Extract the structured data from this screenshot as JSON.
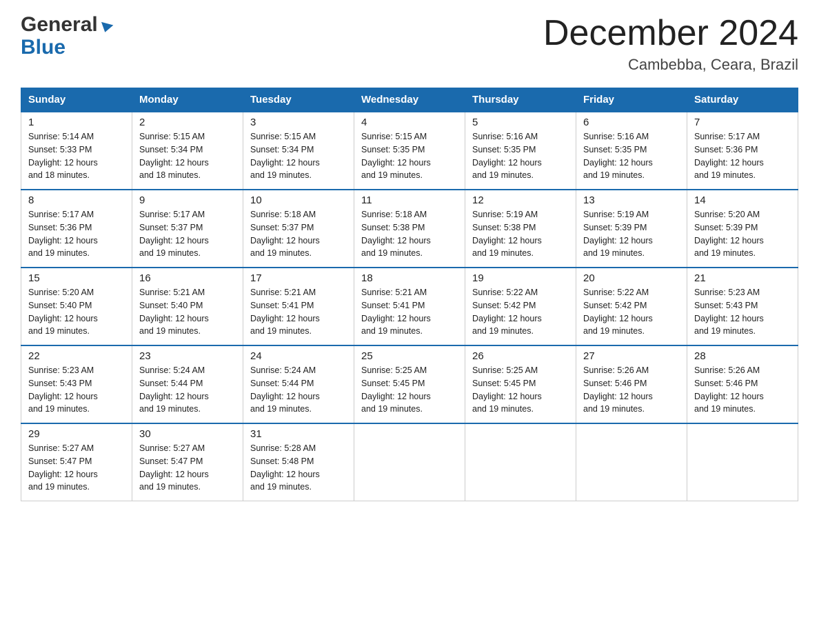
{
  "logo": {
    "line1": "General",
    "line2": "Blue"
  },
  "title": "December 2024",
  "subtitle": "Cambebba, Ceara, Brazil",
  "days_of_week": [
    "Sunday",
    "Monday",
    "Tuesday",
    "Wednesday",
    "Thursday",
    "Friday",
    "Saturday"
  ],
  "weeks": [
    [
      {
        "day": 1,
        "sunrise": "5:14 AM",
        "sunset": "5:33 PM",
        "daylight": "12 hours and 18 minutes."
      },
      {
        "day": 2,
        "sunrise": "5:15 AM",
        "sunset": "5:34 PM",
        "daylight": "12 hours and 18 minutes."
      },
      {
        "day": 3,
        "sunrise": "5:15 AM",
        "sunset": "5:34 PM",
        "daylight": "12 hours and 19 minutes."
      },
      {
        "day": 4,
        "sunrise": "5:15 AM",
        "sunset": "5:35 PM",
        "daylight": "12 hours and 19 minutes."
      },
      {
        "day": 5,
        "sunrise": "5:16 AM",
        "sunset": "5:35 PM",
        "daylight": "12 hours and 19 minutes."
      },
      {
        "day": 6,
        "sunrise": "5:16 AM",
        "sunset": "5:35 PM",
        "daylight": "12 hours and 19 minutes."
      },
      {
        "day": 7,
        "sunrise": "5:17 AM",
        "sunset": "5:36 PM",
        "daylight": "12 hours and 19 minutes."
      }
    ],
    [
      {
        "day": 8,
        "sunrise": "5:17 AM",
        "sunset": "5:36 PM",
        "daylight": "12 hours and 19 minutes."
      },
      {
        "day": 9,
        "sunrise": "5:17 AM",
        "sunset": "5:37 PM",
        "daylight": "12 hours and 19 minutes."
      },
      {
        "day": 10,
        "sunrise": "5:18 AM",
        "sunset": "5:37 PM",
        "daylight": "12 hours and 19 minutes."
      },
      {
        "day": 11,
        "sunrise": "5:18 AM",
        "sunset": "5:38 PM",
        "daylight": "12 hours and 19 minutes."
      },
      {
        "day": 12,
        "sunrise": "5:19 AM",
        "sunset": "5:38 PM",
        "daylight": "12 hours and 19 minutes."
      },
      {
        "day": 13,
        "sunrise": "5:19 AM",
        "sunset": "5:39 PM",
        "daylight": "12 hours and 19 minutes."
      },
      {
        "day": 14,
        "sunrise": "5:20 AM",
        "sunset": "5:39 PM",
        "daylight": "12 hours and 19 minutes."
      }
    ],
    [
      {
        "day": 15,
        "sunrise": "5:20 AM",
        "sunset": "5:40 PM",
        "daylight": "12 hours and 19 minutes."
      },
      {
        "day": 16,
        "sunrise": "5:21 AM",
        "sunset": "5:40 PM",
        "daylight": "12 hours and 19 minutes."
      },
      {
        "day": 17,
        "sunrise": "5:21 AM",
        "sunset": "5:41 PM",
        "daylight": "12 hours and 19 minutes."
      },
      {
        "day": 18,
        "sunrise": "5:21 AM",
        "sunset": "5:41 PM",
        "daylight": "12 hours and 19 minutes."
      },
      {
        "day": 19,
        "sunrise": "5:22 AM",
        "sunset": "5:42 PM",
        "daylight": "12 hours and 19 minutes."
      },
      {
        "day": 20,
        "sunrise": "5:22 AM",
        "sunset": "5:42 PM",
        "daylight": "12 hours and 19 minutes."
      },
      {
        "day": 21,
        "sunrise": "5:23 AM",
        "sunset": "5:43 PM",
        "daylight": "12 hours and 19 minutes."
      }
    ],
    [
      {
        "day": 22,
        "sunrise": "5:23 AM",
        "sunset": "5:43 PM",
        "daylight": "12 hours and 19 minutes."
      },
      {
        "day": 23,
        "sunrise": "5:24 AM",
        "sunset": "5:44 PM",
        "daylight": "12 hours and 19 minutes."
      },
      {
        "day": 24,
        "sunrise": "5:24 AM",
        "sunset": "5:44 PM",
        "daylight": "12 hours and 19 minutes."
      },
      {
        "day": 25,
        "sunrise": "5:25 AM",
        "sunset": "5:45 PM",
        "daylight": "12 hours and 19 minutes."
      },
      {
        "day": 26,
        "sunrise": "5:25 AM",
        "sunset": "5:45 PM",
        "daylight": "12 hours and 19 minutes."
      },
      {
        "day": 27,
        "sunrise": "5:26 AM",
        "sunset": "5:46 PM",
        "daylight": "12 hours and 19 minutes."
      },
      {
        "day": 28,
        "sunrise": "5:26 AM",
        "sunset": "5:46 PM",
        "daylight": "12 hours and 19 minutes."
      }
    ],
    [
      {
        "day": 29,
        "sunrise": "5:27 AM",
        "sunset": "5:47 PM",
        "daylight": "12 hours and 19 minutes."
      },
      {
        "day": 30,
        "sunrise": "5:27 AM",
        "sunset": "5:47 PM",
        "daylight": "12 hours and 19 minutes."
      },
      {
        "day": 31,
        "sunrise": "5:28 AM",
        "sunset": "5:48 PM",
        "daylight": "12 hours and 19 minutes."
      },
      null,
      null,
      null,
      null
    ]
  ],
  "labels": {
    "sunrise": "Sunrise:",
    "sunset": "Sunset:",
    "daylight": "Daylight:"
  }
}
